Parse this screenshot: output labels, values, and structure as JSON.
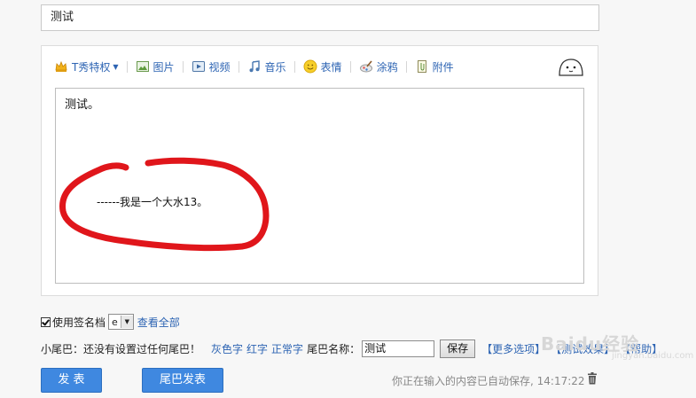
{
  "title_input": {
    "value": "测试"
  },
  "toolbar": {
    "items": [
      {
        "label": "T秀特权",
        "icon": "crown-icon"
      },
      {
        "label": "图片",
        "icon": "image-icon"
      },
      {
        "label": "视频",
        "icon": "video-icon"
      },
      {
        "label": "音乐",
        "icon": "music-icon"
      },
      {
        "label": "表情",
        "icon": "smiley-icon"
      },
      {
        "label": "涂鸦",
        "icon": "brush-icon"
      },
      {
        "label": "附件",
        "icon": "attachment-icon"
      }
    ]
  },
  "content": {
    "line1": "测试。",
    "line2": "------我是一个大水13。"
  },
  "signature": {
    "checkbox_label": "使用签名档",
    "select_value": "e",
    "view_all": "查看全部"
  },
  "tail": {
    "label": "小尾巴：还没有设置过任何尾巴！",
    "gray_text": "灰色字",
    "red_text": "红字",
    "normal_text": "正常字",
    "name_label": "尾巴名称：",
    "name_value": "测试",
    "save": "保存",
    "more": "【更多选项】",
    "test": "【测试效果】",
    "help": "【帮助】"
  },
  "buttons": {
    "post": "发 表",
    "tail_post": "尾巴发表"
  },
  "status": {
    "autosave": "你正在输入的内容已自动保存, 14:17:22"
  },
  "watermark": {
    "text": "Baidu经验",
    "sub": "jingyan.baidu.com"
  },
  "colors": {
    "link": "#2d64b3",
    "button": "#3f88e0",
    "scribble": "#e0161b"
  }
}
